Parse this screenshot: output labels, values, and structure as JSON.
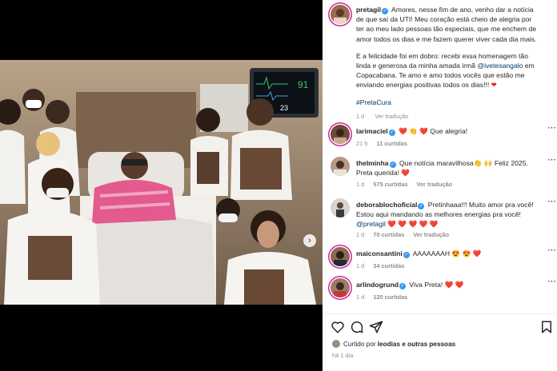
{
  "post": {
    "author": "pretagil",
    "caption_p1": "Amores, nesse fim de ano, venho dar a notícia de que saí da UTI! Meu coração está cheio de alegria por ter ao meu lado pessoas tão especiais, que me enchem de amor todos os dias e me fazem querer viver cada dia mais.",
    "caption_p2a": "E a felicidade foi em dobro: recebi essa homenagem tão linda e generosa da minha amada irmã ",
    "caption_mention": "@ivetesangalo",
    "caption_p2b": " em Copacabana. Te amo e amo todos vocês que estão me enviando energias positivas todos os dias!!! ",
    "hashtag": "#PretaCura",
    "time": "1 d",
    "see_translation": "Ver tradução"
  },
  "monitor": {
    "value_top": "91",
    "value_bottom": "23"
  },
  "comments": [
    {
      "user": "larimaciel",
      "text": " ❤️ 👏 ❤️ Que alegria!",
      "time": "21 h",
      "likes": "11 curtidas",
      "translate": ""
    },
    {
      "user": "thelminha",
      "text": " Que notícia maravilhosa👏 🙌 Feliz 2025. Preta querida! ❤️",
      "time": "1 d",
      "likes": "575 curtidas",
      "translate": "Ver tradução"
    },
    {
      "user": "deborablochoficial",
      "text": " Pretinhaaa!!! Muito amor pra você! Estou aqui mandando as melhores energias pra você! ",
      "mention": "@pretagil",
      "text2": " ❤️ ❤️ ❤️ ❤️ ❤️",
      "time": "1 d",
      "likes": "70 curtidas",
      "translate": "Ver tradução"
    },
    {
      "user": "maiconsantini",
      "text": " AAAAAAAH 😍 😍 ❤️",
      "time": "1 d",
      "likes": "34 curtidas",
      "translate": ""
    },
    {
      "user": "arlindogrund",
      "text": " Viva Preta! ❤️ ❤️",
      "time": "1 d",
      "likes": "120 curtidas",
      "translate": ""
    }
  ],
  "liked_by": {
    "prefix": "Curtido por ",
    "user": "leodias",
    "suffix": " e outras pessoas"
  },
  "posted_ago": "há 1 dia",
  "icons": [
    "heart-icon",
    "comment-icon",
    "share-icon",
    "bookmark-icon",
    "verified-badge",
    "more-options-icon",
    "carousel-next-icon"
  ],
  "colors": {
    "verified": "#3897f0",
    "link": "#00376b",
    "heart": "#ed1c24",
    "muted": "#8e8e8e"
  }
}
